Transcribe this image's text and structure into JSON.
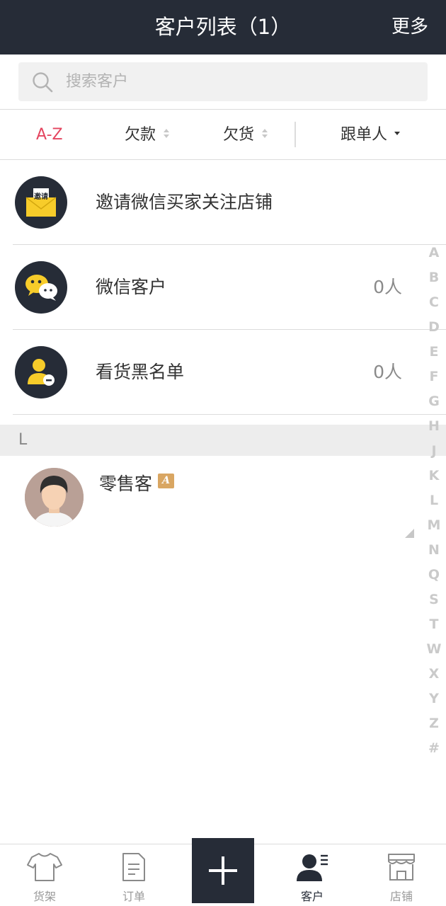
{
  "header": {
    "title": "客户列表（1）",
    "more_label": "更多"
  },
  "search": {
    "placeholder": "搜索客户"
  },
  "sort_bar": {
    "items": [
      {
        "label": "A-Z",
        "active": true
      },
      {
        "label": "欠款",
        "active": false
      },
      {
        "label": "欠货",
        "active": false
      },
      {
        "label": "跟单人",
        "active": false
      }
    ]
  },
  "rows": [
    {
      "label": "邀请微信买家关注店铺",
      "icon": "invite-envelope-icon",
      "icon_text": "邀请"
    },
    {
      "label": "微信客户",
      "count": "0人",
      "icon": "wechat-icon"
    },
    {
      "label": "看货黑名单",
      "count": "0人",
      "icon": "user-blocked-icon"
    }
  ],
  "section": {
    "letter": "L"
  },
  "customers": [
    {
      "name": "零售客",
      "badge": "A"
    }
  ],
  "index_letters": [
    "A",
    "B",
    "C",
    "D",
    "E",
    "F",
    "G",
    "H",
    "J",
    "K",
    "L",
    "M",
    "N",
    "Q",
    "S",
    "T",
    "W",
    "X",
    "Y",
    "Z",
    "#"
  ],
  "tabbar": {
    "items": [
      {
        "label": "货架",
        "icon": "shirt-icon"
      },
      {
        "label": "订单",
        "icon": "document-icon"
      },
      {
        "label": "",
        "icon": "plus-icon"
      },
      {
        "label": "客户",
        "icon": "customer-list-icon",
        "active": true
      },
      {
        "label": "店铺",
        "icon": "store-icon"
      }
    ]
  },
  "colors": {
    "header_bg": "#262c37",
    "accent": "#e4455f",
    "icon_yellow": "#f7cc2a",
    "badge": "#d9a662"
  }
}
